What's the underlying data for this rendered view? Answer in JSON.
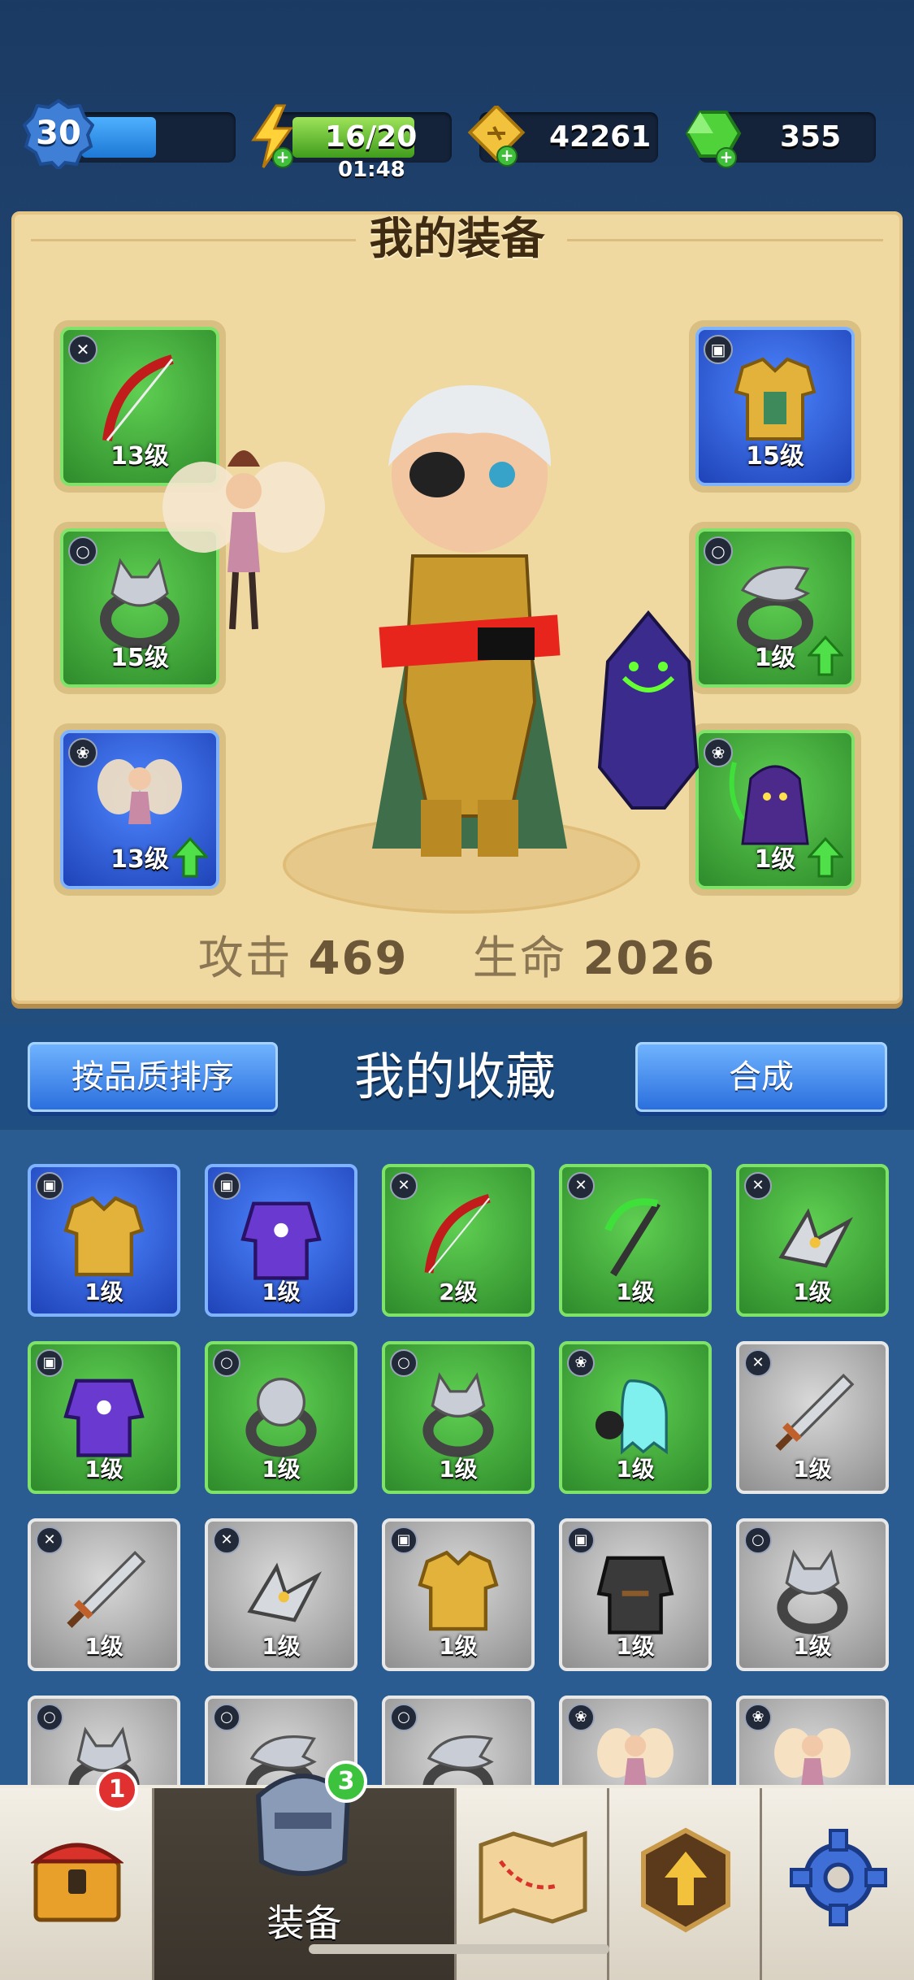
{
  "top_bar": {
    "level": "30",
    "xp_progress": 0.4,
    "energy": "16/20",
    "energy_progress": 0.8,
    "energy_timer": "01:48",
    "gold": "42261",
    "gems": "355"
  },
  "equip_panel": {
    "title": "我的装备",
    "slots": {
      "weapon": {
        "level": "13级",
        "icon": "bow-icon",
        "rarity": "green"
      },
      "ring_left": {
        "level": "15级",
        "icon": "wolf-ring-icon",
        "rarity": "green"
      },
      "pet_left": {
        "level": "13级",
        "icon": "fairy-icon",
        "rarity": "blue",
        "upgradable": true
      },
      "armor": {
        "level": "15级",
        "icon": "gold-armor-icon",
        "rarity": "blue"
      },
      "ring_right": {
        "level": "1级",
        "icon": "eagle-ring-icon",
        "rarity": "green",
        "upgradable": true
      },
      "pet_right": {
        "level": "1级",
        "icon": "reaper-icon",
        "rarity": "green",
        "upgradable": true
      }
    },
    "stats": {
      "attack_label": "攻击",
      "attack_value": "469",
      "hp_label": "生命",
      "hp_value": "2026"
    }
  },
  "collection": {
    "sort_button": "按品质排序",
    "title": "我的收藏",
    "merge_button": "合成",
    "items": [
      {
        "level": "1级",
        "icon": "gold-armor-icon",
        "rarity": "blue",
        "badge": "armor"
      },
      {
        "level": "1级",
        "icon": "purple-robe-icon",
        "rarity": "blue",
        "badge": "armor"
      },
      {
        "level": "2级",
        "icon": "bow-icon",
        "rarity": "green",
        "badge": "weapon"
      },
      {
        "level": "1级",
        "icon": "scythe-icon",
        "rarity": "green",
        "badge": "weapon"
      },
      {
        "level": "1级",
        "icon": "boomerang-icon",
        "rarity": "green",
        "badge": "weapon"
      },
      {
        "level": "1级",
        "icon": "purple-robe-icon",
        "rarity": "green",
        "badge": "armor"
      },
      {
        "level": "1级",
        "icon": "bear-ring-icon",
        "rarity": "green",
        "badge": "ring"
      },
      {
        "level": "1级",
        "icon": "wolf-ring-icon",
        "rarity": "green",
        "badge": "ring"
      },
      {
        "level": "1级",
        "icon": "ghost-bomb-icon",
        "rarity": "green",
        "badge": "pet"
      },
      {
        "level": "1级",
        "icon": "sword-icon",
        "rarity": "gray",
        "badge": "weapon"
      },
      {
        "level": "1级",
        "icon": "sword-icon",
        "rarity": "gray",
        "badge": "weapon"
      },
      {
        "level": "1级",
        "icon": "boomerang-icon",
        "rarity": "gray",
        "badge": "weapon"
      },
      {
        "level": "1级",
        "icon": "gold-armor-icon",
        "rarity": "gray",
        "badge": "armor"
      },
      {
        "level": "1级",
        "icon": "dark-vest-icon",
        "rarity": "gray",
        "badge": "armor"
      },
      {
        "level": "1级",
        "icon": "wolf-ring-icon",
        "rarity": "gray",
        "badge": "ring"
      },
      {
        "level": "",
        "icon": "wolf-ring-icon",
        "rarity": "gray",
        "badge": "ring"
      },
      {
        "level": "",
        "icon": "eagle-ring-icon",
        "rarity": "gray",
        "badge": "ring"
      },
      {
        "level": "",
        "icon": "eagle-ring-icon",
        "rarity": "gray",
        "badge": "ring"
      },
      {
        "level": "",
        "icon": "fairy-icon",
        "rarity": "gray",
        "badge": "pet"
      },
      {
        "level": "",
        "icon": "fairy-icon",
        "rarity": "gray",
        "badge": "pet"
      }
    ]
  },
  "bottom_nav": {
    "items": [
      {
        "icon": "treasure-chest-icon",
        "label": "",
        "notif": "1"
      },
      {
        "icon": "armor-helmet-icon",
        "label": "装备",
        "notif": "3"
      },
      {
        "icon": "map-icon",
        "label": ""
      },
      {
        "icon": "upgrade-shield-icon",
        "label": ""
      },
      {
        "icon": "settings-gear-icon",
        "label": ""
      }
    ]
  },
  "colors": {
    "panel_bg": "#efd9a1",
    "rarity_green": "#3fae35",
    "rarity_blue": "#2f5fe0",
    "rarity_gray": "#b5b5b5",
    "notif_red": "#e03030",
    "notif_green": "#3cc23c"
  }
}
